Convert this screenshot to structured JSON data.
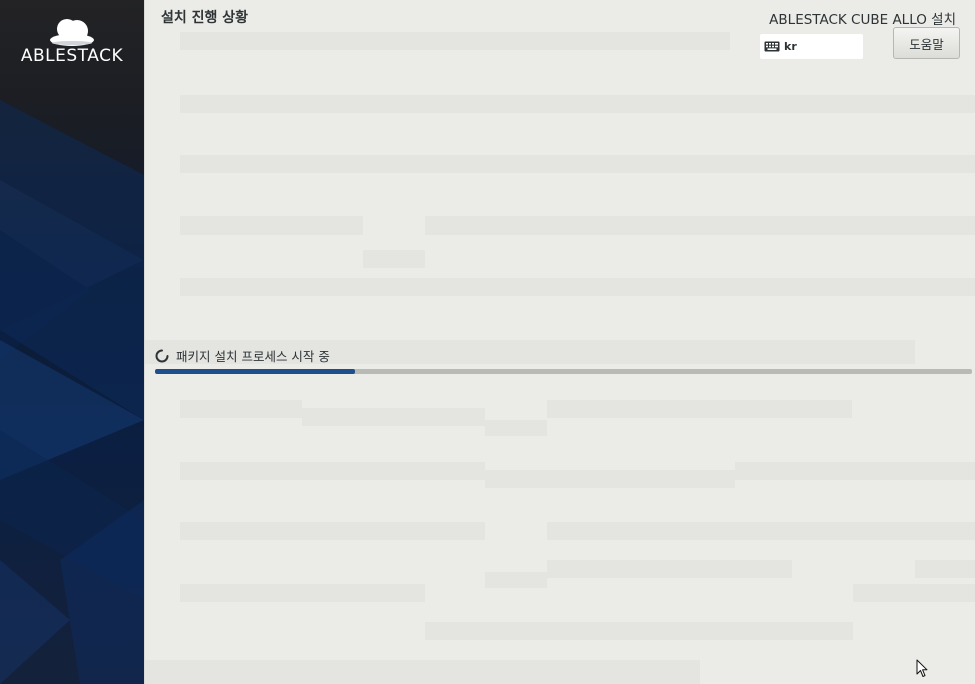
{
  "sidebar": {
    "logo_text": "ABLESTACK"
  },
  "header": {
    "page_title": "설치 진행 상황",
    "product_title": "ABLESTACK CUBE ALLO 설치",
    "keyboard_layout": "kr",
    "help_label": "도움말"
  },
  "progress": {
    "status_text": "패키지 설치 프로세스 시작 중",
    "fraction": 0.245,
    "fill_color": "#1f4e8c",
    "track_color": "#b9b9b6"
  },
  "icons": {
    "keyboard": "keyboard-icon",
    "spinner": "spinner-icon",
    "cursor": "mouse-pointer-icon",
    "logo": "cloud-logo-icon"
  },
  "colors": {
    "sidebar_dark": "#0b1f42",
    "accent_blue": "#1f4e8c",
    "background": "#ebebe8"
  }
}
